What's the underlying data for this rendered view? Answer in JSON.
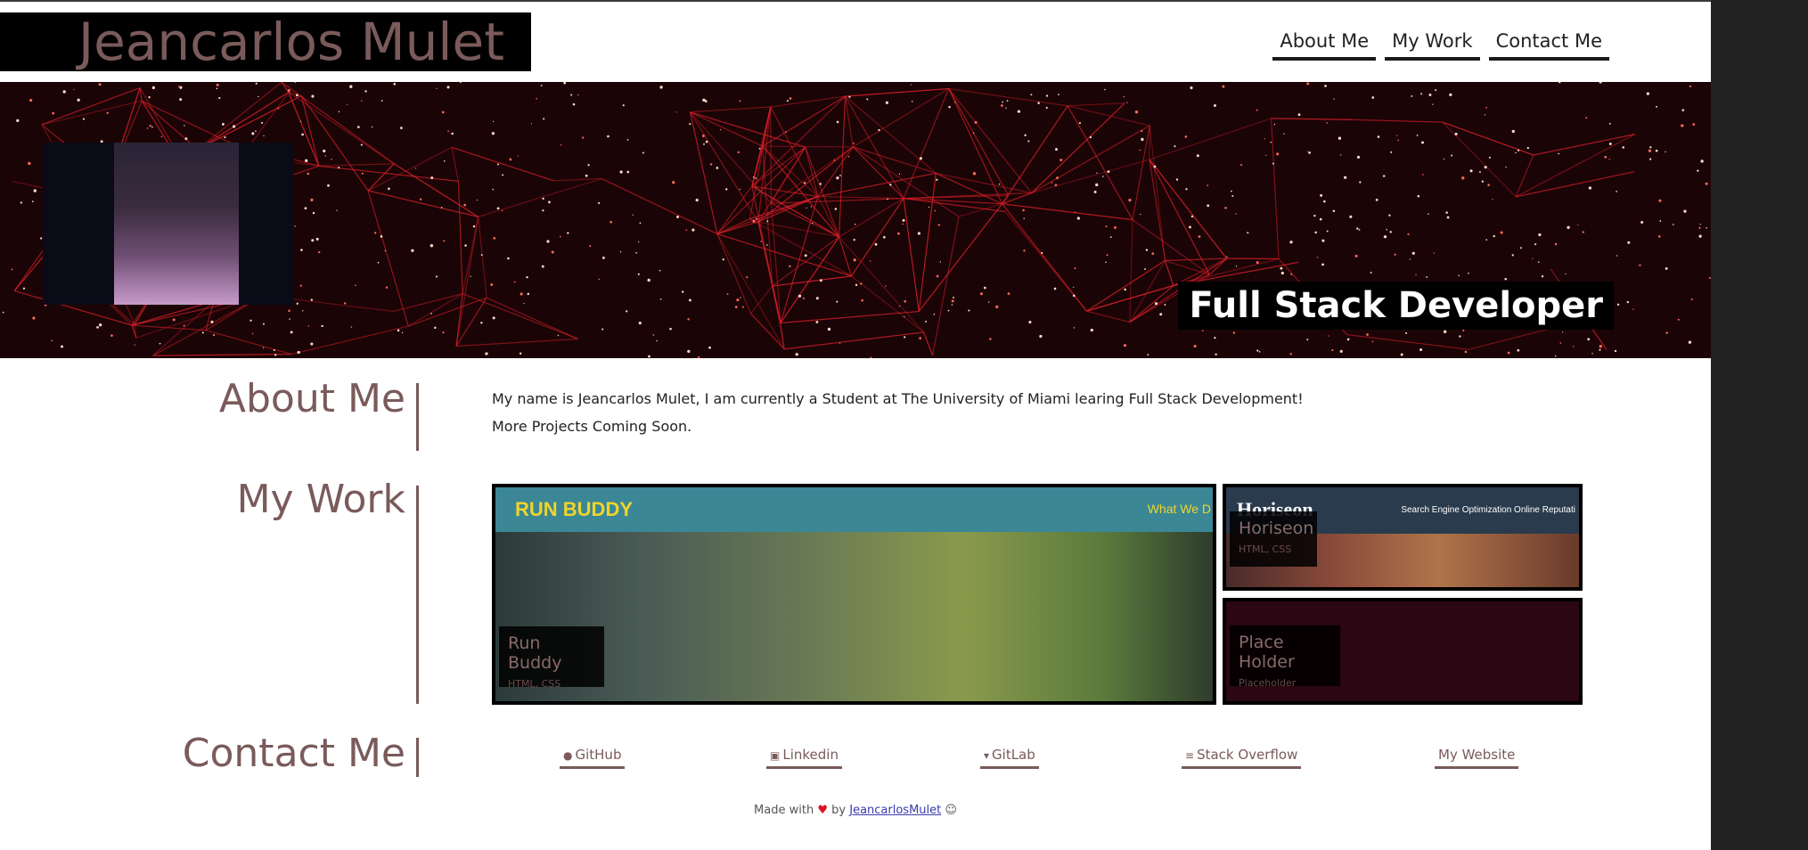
{
  "header": {
    "site_title": "Jeancarlos Mulet",
    "nav": [
      "About Me",
      "My Work",
      "Contact Me"
    ]
  },
  "hero": {
    "role": "Full Stack Developer"
  },
  "about": {
    "heading": "About Me",
    "lines": [
      "My name is Jeancarlos Mulet, I am currently a Student at The University of Miami learing Full Stack Development!",
      "More Projects Coming Soon."
    ]
  },
  "work": {
    "heading": "My Work",
    "cards": [
      {
        "name": "Run Buddy",
        "tech": "HTML, CSS",
        "preview_title": "RUN BUDDY",
        "preview_nav": "What We D"
      },
      {
        "name": "Horiseon",
        "tech": "HTML, CSS",
        "preview_title": "Horiseon",
        "preview_nav": "Search Engine Optimization     Online Reputati"
      },
      {
        "name": "Place Holder",
        "tech": "Placeholder"
      }
    ]
  },
  "contact": {
    "heading": "Contact Me",
    "links": [
      {
        "label": "GitHub",
        "icon": "github-icon"
      },
      {
        "label": "Linkedin",
        "icon": "linkedin-icon"
      },
      {
        "label": "GitLab",
        "icon": "gitlab-icon"
      },
      {
        "label": "Stack Overflow",
        "icon": "stackoverflow-icon"
      },
      {
        "label": "My Website",
        "icon": ""
      }
    ]
  },
  "footer": {
    "made_with": "Made with",
    "by": "by",
    "author": "JeancarlosMulet"
  },
  "colors": {
    "accent": "#7a5a5a",
    "hero_bg": "#1b0406",
    "runbuddy_bar": "#3b8796",
    "runbuddy_title": "#f1d42a"
  }
}
